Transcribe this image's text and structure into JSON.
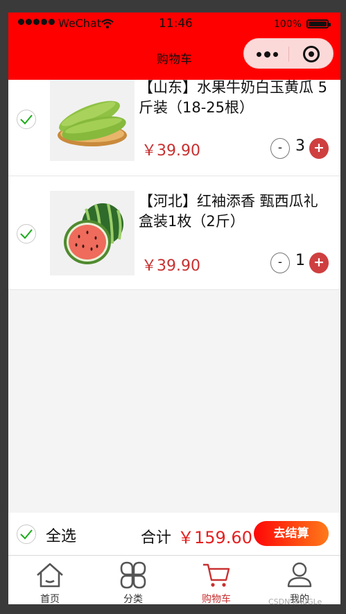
{
  "status_bar": {
    "carrier": "WeChat",
    "time": "11:46",
    "battery": "100%"
  },
  "nav": {
    "title": "购物车"
  },
  "items": [
    {
      "name": "【山东】水果牛奶白玉黄瓜 5斤装（18-25根）",
      "price": "￥39.90",
      "quantity": "3",
      "minus": "-",
      "plus": "+"
    },
    {
      "name": "【河北】红袖添香 甄西瓜礼盒装1枚（2斤）",
      "price": "￥39.90",
      "quantity": "1",
      "minus": "-",
      "plus": "+"
    }
  ],
  "checkout": {
    "select_all": "全选",
    "total_label": "合计",
    "total_value": "￥159.60",
    "pay_button": "去结算"
  },
  "tabbar": {
    "tabs": [
      {
        "label": "首页",
        "icon": "home-icon"
      },
      {
        "label": "分类",
        "icon": "category-icon"
      },
      {
        "label": "购物车",
        "icon": "cart-icon",
        "active": true
      },
      {
        "label": "我的",
        "icon": "profile-icon"
      }
    ],
    "watermark": "CSDN @JuGLe_"
  },
  "colors": {
    "brand": "#fe0000",
    "price": "#c83131",
    "check": "#1aad19"
  }
}
